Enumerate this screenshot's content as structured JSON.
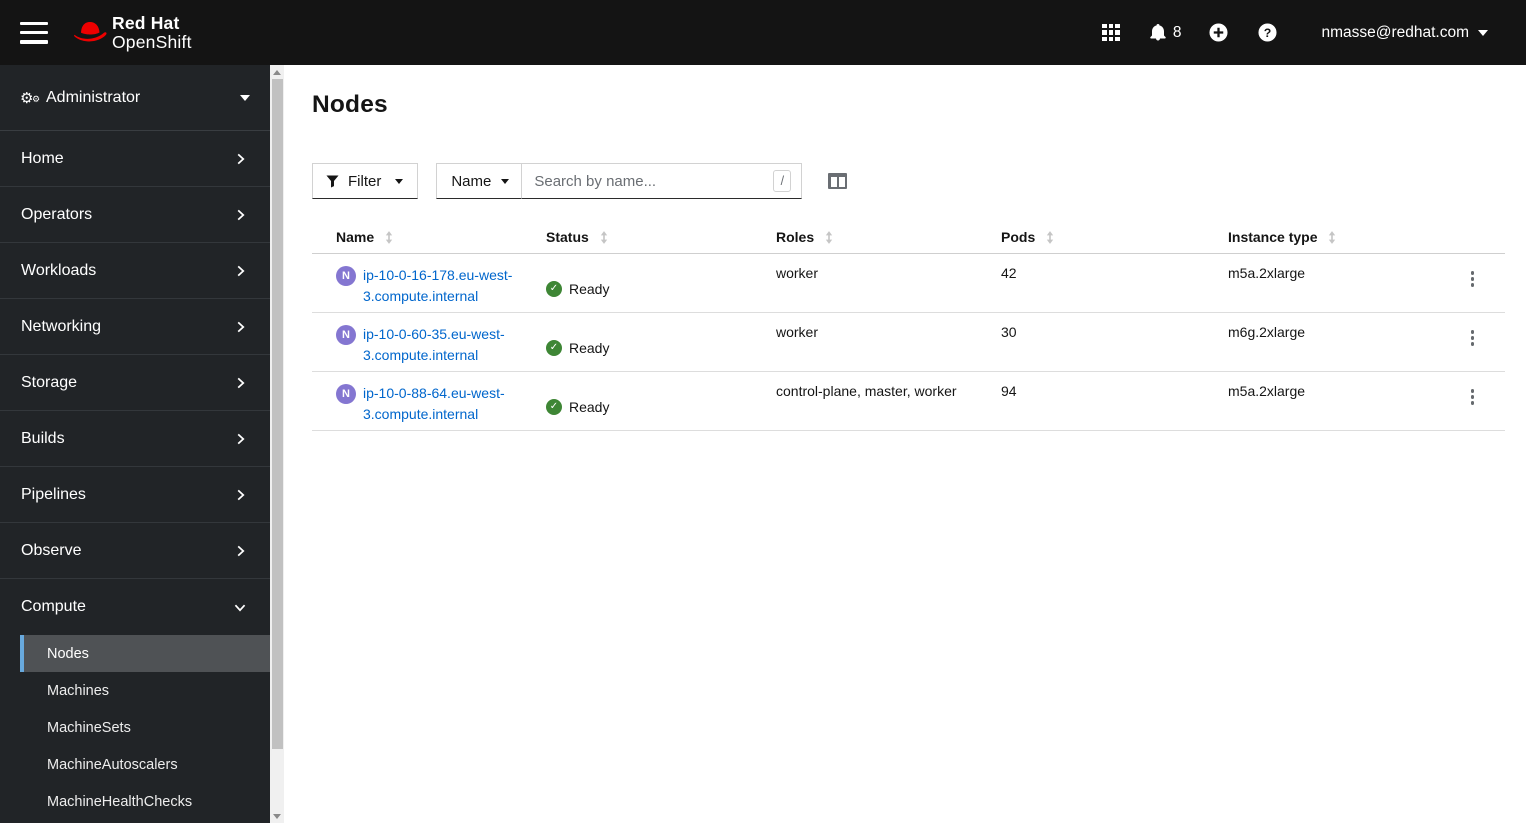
{
  "header": {
    "brand_line1": "Red Hat",
    "brand_line2": "OpenShift",
    "notification_count": "8",
    "user_menu": "nmasse@redhat.com"
  },
  "sidebar": {
    "perspective": "Administrator",
    "items": [
      {
        "label": "Home"
      },
      {
        "label": "Operators"
      },
      {
        "label": "Workloads"
      },
      {
        "label": "Networking"
      },
      {
        "label": "Storage"
      },
      {
        "label": "Builds"
      },
      {
        "label": "Pipelines"
      },
      {
        "label": "Observe"
      }
    ],
    "compute": {
      "label": "Compute",
      "subitems": [
        {
          "label": "Nodes",
          "selected": true
        },
        {
          "label": "Machines",
          "selected": false
        },
        {
          "label": "MachineSets",
          "selected": false
        },
        {
          "label": "MachineAutoscalers",
          "selected": false
        },
        {
          "label": "MachineHealthChecks",
          "selected": false
        }
      ]
    }
  },
  "main": {
    "page_title": "Nodes",
    "toolbar": {
      "filter_label": "Filter",
      "search_attribute": "Name",
      "search_placeholder": "Search by name...",
      "search_shortcut": "/"
    },
    "table": {
      "columns": [
        "Name",
        "Status",
        "Roles",
        "Pods",
        "Instance type"
      ],
      "rows": [
        {
          "badge": "N",
          "name": "ip-10-0-16-178.eu-west-3.compute.internal",
          "status": "Ready",
          "roles": "worker",
          "pods": "42",
          "instance_type": "m5a.2xlarge"
        },
        {
          "badge": "N",
          "name": "ip-10-0-60-35.eu-west-3.compute.internal",
          "status": "Ready",
          "roles": "worker",
          "pods": "30",
          "instance_type": "m6g.2xlarge"
        },
        {
          "badge": "N",
          "name": "ip-10-0-88-64.eu-west-3.compute.internal",
          "status": "Ready",
          "roles": "control-plane, master, worker",
          "pods": "94",
          "instance_type": "m5a.2xlarge"
        }
      ]
    }
  },
  "icons": {
    "ready_check": "✓",
    "cog": "⚙"
  },
  "colors": {
    "brand_red": "#ee0000",
    "masthead_bg": "#141414",
    "sidebar_bg": "#212427",
    "nav_selected_bg": "#4f5255",
    "nav_selected_indicator": "#68a9dd",
    "link": "#0066cc",
    "success_green": "#3e8635",
    "node_badge_purple": "#8476d1"
  }
}
